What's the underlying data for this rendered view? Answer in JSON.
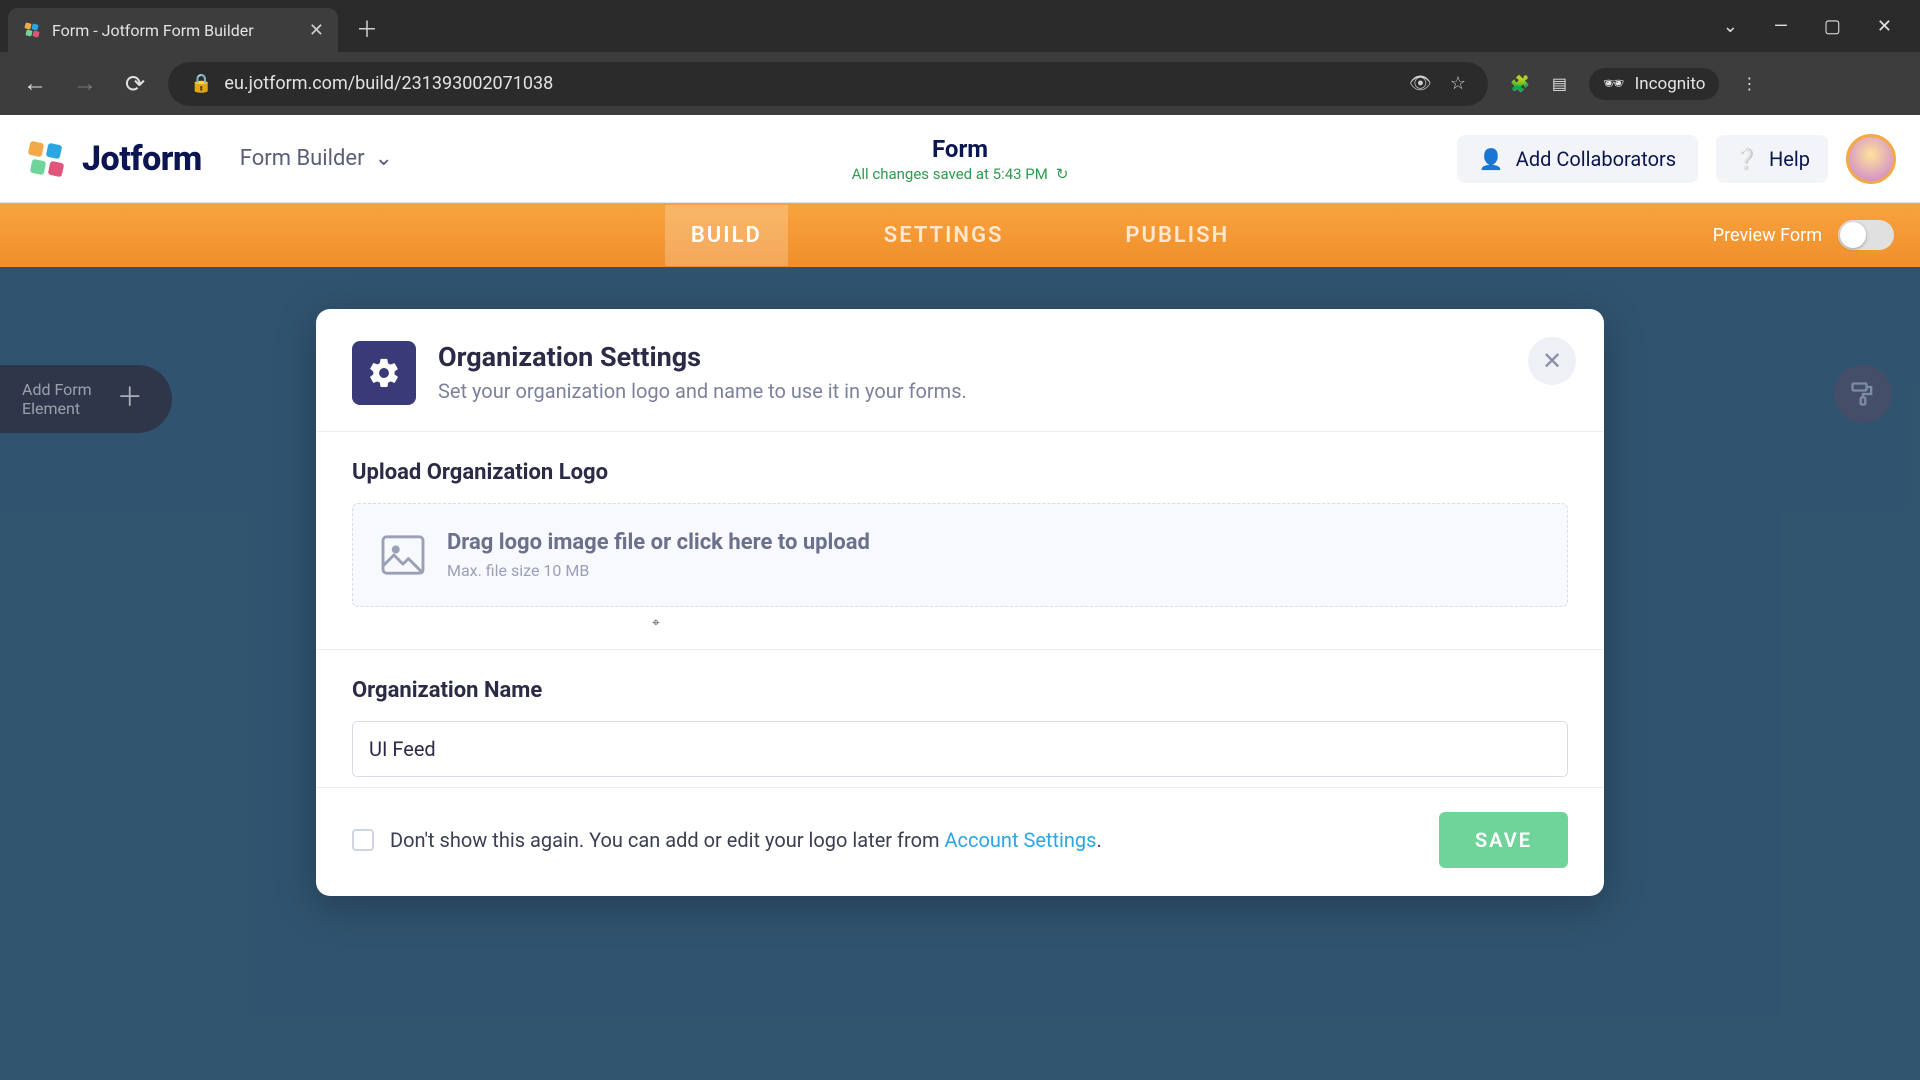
{
  "browser": {
    "tab_title": "Form - Jotform Form Builder",
    "url": "eu.jotform.com/build/231393002071038",
    "incognito_label": "Incognito"
  },
  "header": {
    "brand": "Jotform",
    "builder_label": "Form Builder",
    "form_title": "Form",
    "save_status": "All changes saved at 5:43 PM",
    "collab_label": "Add Collaborators",
    "help_label": "Help"
  },
  "tabs": {
    "build": "BUILD",
    "settings": "SETTINGS",
    "publish": "PUBLISH",
    "preview_label": "Preview Form"
  },
  "sidebar": {
    "add_element_line1": "Add Form",
    "add_element_line2": "Element"
  },
  "modal": {
    "title": "Organization Settings",
    "subtitle": "Set your organization logo and name to use it in your forms.",
    "upload_label": "Upload Organization Logo",
    "upload_prompt": "Drag logo image file or click here to upload",
    "upload_hint": "Max. file size 10 MB",
    "name_label": "Organization Name",
    "name_value": "UI Feed",
    "dont_show_prefix": "Don't show this again. You can add or edit your logo later from ",
    "dont_show_link": "Account Settings",
    "dont_show_suffix": ".",
    "save_label": "SAVE"
  }
}
